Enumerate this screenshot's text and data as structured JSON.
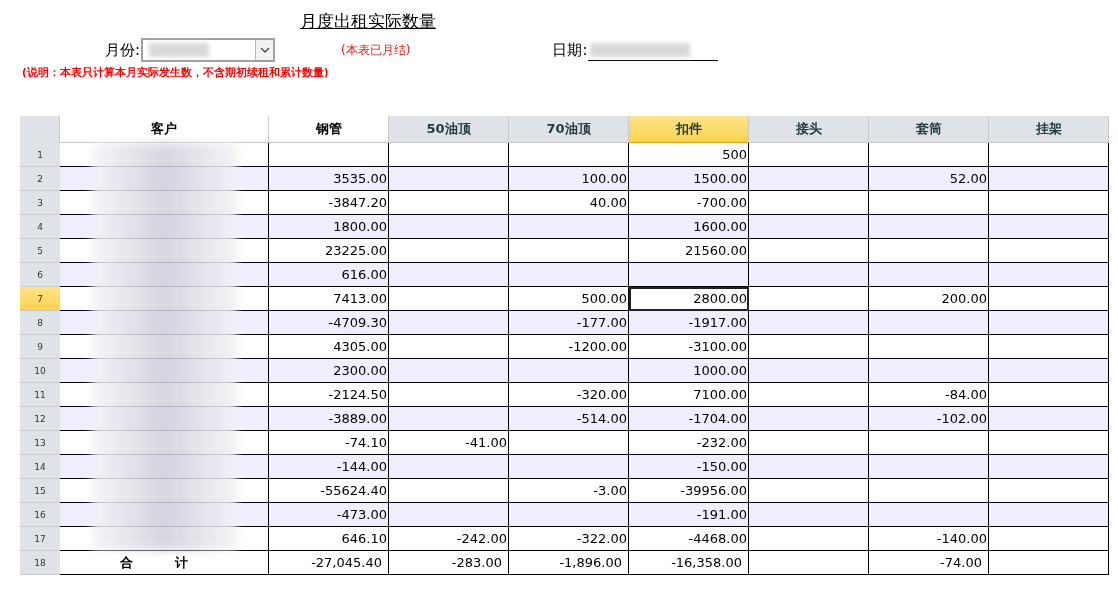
{
  "title": "月度出租实际数量",
  "month": {
    "label": "月份:",
    "redacted": true
  },
  "closed_note": "(本表已月结)",
  "date": {
    "label": "日期:",
    "redacted": true
  },
  "note": "(说明：本表只计算本月实际发生数，不含期初续租和累计数量)",
  "table": {
    "customer_redacted": true,
    "columns": [
      {
        "label": "客户",
        "shaded": false,
        "selected": false
      },
      {
        "label": "钢管",
        "shaded": false,
        "selected": false
      },
      {
        "label": "50油顶",
        "shaded": true,
        "selected": false
      },
      {
        "label": "70油顶",
        "shaded": true,
        "selected": false
      },
      {
        "label": "扣件",
        "shaded": true,
        "selected": true
      },
      {
        "label": "接头",
        "shaded": true,
        "selected": false
      },
      {
        "label": "套筒",
        "shaded": true,
        "selected": false
      },
      {
        "label": "挂架",
        "shaded": true,
        "selected": false
      }
    ],
    "rows": [
      {
        "number": "1",
        "kind": "data",
        "selected": false,
        "cells": [
          null,
          null,
          null,
          "500",
          null,
          null,
          null
        ]
      },
      {
        "number": "2",
        "kind": "data",
        "selected": false,
        "cells": [
          "3535.00",
          null,
          "100.00",
          "1500.00",
          null,
          "52.00",
          null
        ]
      },
      {
        "number": "3",
        "kind": "data",
        "selected": false,
        "cells": [
          "-3847.20",
          null,
          "40.00",
          "-700.00",
          null,
          null,
          null
        ]
      },
      {
        "number": "4",
        "kind": "data",
        "selected": false,
        "cells": [
          "1800.00",
          null,
          null,
          "1600.00",
          null,
          null,
          null
        ]
      },
      {
        "number": "5",
        "kind": "data",
        "selected": false,
        "cells": [
          "23225.00",
          null,
          null,
          "21560.00",
          null,
          null,
          null
        ]
      },
      {
        "number": "6",
        "kind": "data",
        "selected": false,
        "cells": [
          "616.00",
          null,
          null,
          null,
          null,
          null,
          null
        ]
      },
      {
        "number": "7",
        "kind": "data",
        "selected": true,
        "cells": [
          "7413.00",
          null,
          "500.00",
          "2800.00",
          null,
          "200.00",
          null
        ]
      },
      {
        "number": "8",
        "kind": "data",
        "selected": false,
        "cells": [
          "-4709.30",
          null,
          "-177.00",
          "-1917.00",
          null,
          null,
          null
        ]
      },
      {
        "number": "9",
        "kind": "data",
        "selected": false,
        "cells": [
          "4305.00",
          null,
          "-1200.00",
          "-3100.00",
          null,
          null,
          null
        ]
      },
      {
        "number": "10",
        "kind": "data",
        "selected": false,
        "cells": [
          "2300.00",
          null,
          null,
          "1000.00",
          null,
          null,
          null
        ]
      },
      {
        "number": "11",
        "kind": "data",
        "selected": false,
        "cells": [
          "-2124.50",
          null,
          "-320.00",
          "7100.00",
          null,
          "-84.00",
          null
        ]
      },
      {
        "number": "12",
        "kind": "data",
        "selected": false,
        "cells": [
          "-3889.00",
          null,
          "-514.00",
          "-1704.00",
          null,
          "-102.00",
          null
        ]
      },
      {
        "number": "13",
        "kind": "data",
        "selected": false,
        "cells": [
          "-74.10",
          "-41.00",
          null,
          "-232.00",
          null,
          null,
          null
        ]
      },
      {
        "number": "14",
        "kind": "data",
        "selected": false,
        "cells": [
          "-144.00",
          null,
          null,
          "-150.00",
          null,
          null,
          null
        ]
      },
      {
        "number": "15",
        "kind": "data",
        "selected": false,
        "cells": [
          "-55624.40",
          null,
          "-3.00",
          "-39956.00",
          null,
          null,
          null
        ]
      },
      {
        "number": "16",
        "kind": "data",
        "selected": false,
        "cells": [
          "-473.00",
          null,
          null,
          "-191.00",
          null,
          null,
          null
        ]
      },
      {
        "number": "17",
        "kind": "data",
        "selected": false,
        "cells": [
          "646.10",
          "-242.00",
          "-322.00",
          "-4468.00",
          null,
          "-140.00",
          null
        ]
      },
      {
        "number": "18",
        "kind": "total",
        "selected": false,
        "label": "合 计",
        "cells": [
          "-27,045.40",
          "-283.00",
          "-1,896.00",
          "-16,358.00",
          null,
          "-74.00",
          null
        ]
      }
    ]
  }
}
